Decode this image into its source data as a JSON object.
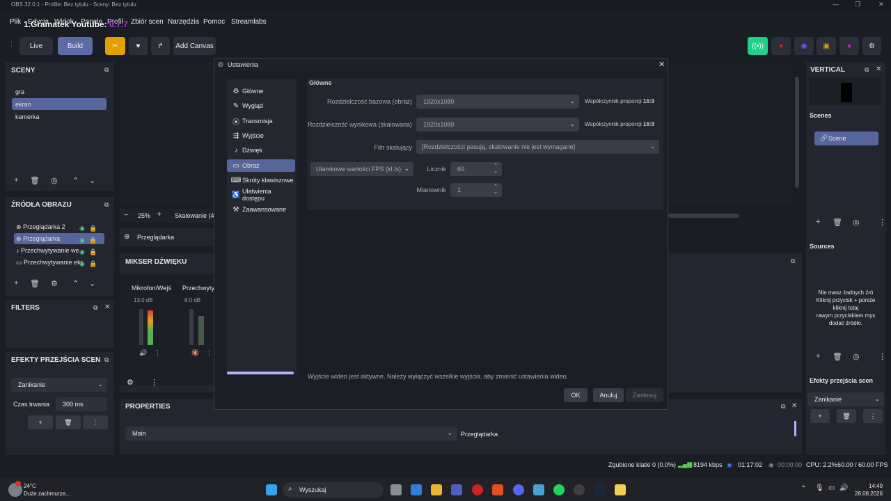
{
  "window": {
    "title": "OBS 32.0.1 - Profile: Bez tytułu - Sceny: Bez tytułu",
    "overlay": "1.Gramatek Youtube:",
    "overlay_num": "0.7.7"
  },
  "menu": [
    "Plik",
    "Edycja",
    "Widok",
    "Panele",
    "Profil",
    "Zbiór scen",
    "Narzędzia",
    "Pomoc",
    "Streamlabs"
  ],
  "toolbar": {
    "live": "Live",
    "build": "Build",
    "add_canvas": "Add Canvas"
  },
  "scenes": {
    "title": "SCENY",
    "items": [
      "gra",
      "ekran",
      "kamerka"
    ],
    "selected": 1
  },
  "sources": {
    "title": "ŹRÓDŁA OBRAZU",
    "items": [
      "Przeglądarka 2",
      "Przeglądarka",
      "Przechwytywanie we",
      "Przechwytywanie ekr"
    ],
    "selected": 1
  },
  "filters": {
    "title": "FILTERS"
  },
  "transitions": {
    "title": "EFEKTY PRZEJŚCIA SCEN",
    "type": "Zanikanie",
    "duration_label": "Czas trwania",
    "duration": "300 ms"
  },
  "preview": {
    "zoom": "25%",
    "scaling": "Skalowanie (4",
    "source_label": "Przeglądarka"
  },
  "mixer": {
    "title": "MIKSER DŹWIĘKU",
    "ch1_name": "Mikrofon/Wejś",
    "ch1_db": "13.0 dB",
    "ch2_name": "Przechwyty",
    "ch2_db": "8.0 dB"
  },
  "properties": {
    "title": "PROPERTIES",
    "combo": "Main",
    "label": "Przeglądarka"
  },
  "vertical": {
    "title": "VERTICAL",
    "scenes_label": "Scenes",
    "scene_item": "Scene",
    "sources_label": "Sources",
    "empty_msg": [
      "Nie masz żadnych źró",
      "Kliknij przycisk + poniże",
      "kliknij tutaj",
      "rawym przyciskiem mys",
      "dodać źródło."
    ],
    "trans_label": "Efekty przejścia scen",
    "trans_value": "Zanikanie"
  },
  "dialog": {
    "title": "Ustawienia",
    "nav": [
      "Główne",
      "Wygląd",
      "Transmisja",
      "Wyjście",
      "Dźwięk",
      "Obraz",
      "Skróty klawiszowe",
      "Ułatwienia dostępu",
      "Zaawansowane"
    ],
    "nav_selected": 5,
    "section": "Główne",
    "base_res_label": "Rozdzielczość bazowa (obraz)",
    "base_res": "1920x1080",
    "out_res_label": "Rozdzielczość wynikowa (skalowana)",
    "out_res": "1920x1080",
    "aspect_label": "Współczynnik proporcji",
    "aspect": "16:9",
    "filter_label": "Filtr skalujący",
    "filter_value": "[Rozdzielczości pasują, skalowanie nie jest wymagane]",
    "fps_type": "Ułamkowe wartości FPS (kl./s)",
    "num_label": "Licznik",
    "num_value": "60",
    "den_label": "Mianownik",
    "den_value": "1",
    "warning": "Wyjście wideo jest aktywne. Należy wyłączyć wszelkie wyjścia, aby zmienić ustawienia wideo.",
    "ok": "OK",
    "cancel": "Anuluj",
    "apply": "Zastosuj"
  },
  "status": {
    "dropped": "Zgubione klatki 0 (0.0%)",
    "kbps": "8194 kbps",
    "stream_time": "01:17:02",
    "rec_time": "00:00:00",
    "cpu": "CPU: 2.2%",
    "fps": "60.00 / 60.00 FPS"
  },
  "taskbar": {
    "temp": "24°C",
    "weather": "Duże zachmurze...",
    "search": "Wyszukaj",
    "time": "14:49",
    "date": "28.08.2026"
  }
}
